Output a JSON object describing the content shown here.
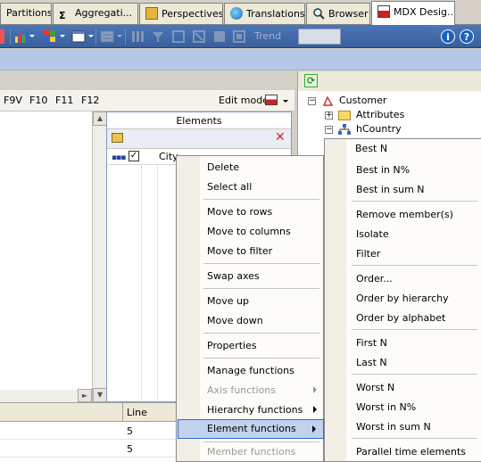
{
  "tabs": [
    {
      "label": "Partitions",
      "icon": "partitions-icon"
    },
    {
      "label": "Aggregati...",
      "icon": "sigma-icon"
    },
    {
      "label": "Perspectives",
      "icon": "perspectives-icon"
    },
    {
      "label": "Translations",
      "icon": "globe-icon"
    },
    {
      "label": "Browser",
      "icon": "magnifier-icon"
    },
    {
      "label": "MDX Desig...",
      "icon": "mdx-designer-icon",
      "active": true
    }
  ],
  "toolbar": {
    "trend_label": "Trend"
  },
  "fkeys": [
    "F9V",
    "F10",
    "F11",
    "F12"
  ],
  "edit_mode_label": "Edit mode",
  "elements": {
    "header": "Elements",
    "row_label": "City"
  },
  "bottom_grid": {
    "line_header": "Line",
    "rows": [
      "5",
      "5"
    ]
  },
  "tree": {
    "customer": "Customer",
    "attributes": "Attributes",
    "hcountry": "hCountry"
  },
  "context_menu": {
    "items": [
      {
        "label": "Delete"
      },
      {
        "label": "Select all"
      },
      {
        "label": "Move to rows"
      },
      {
        "label": "Move to columns"
      },
      {
        "label": "Move to filter"
      },
      {
        "label": "Swap axes"
      },
      {
        "label": "Move up"
      },
      {
        "label": "Move down"
      },
      {
        "label": "Properties"
      },
      {
        "label": "Manage functions"
      },
      {
        "label": "Axis functions",
        "disabled": true,
        "submenu": true
      },
      {
        "label": "Hierarchy functions",
        "submenu": true
      },
      {
        "label": "Element functions",
        "submenu": true,
        "selected": true
      },
      {
        "label": "Member functions",
        "disabled": true
      }
    ]
  },
  "submenu": {
    "items": [
      {
        "label": "Best N",
        "selected": true
      },
      {
        "label": "Best in N%"
      },
      {
        "label": "Best in sum N"
      },
      {
        "label": "Remove member(s)"
      },
      {
        "label": "Isolate"
      },
      {
        "label": "Filter"
      },
      {
        "label": "Order..."
      },
      {
        "label": "Order by hierarchy"
      },
      {
        "label": "Order by alphabet"
      },
      {
        "label": "First N"
      },
      {
        "label": "Last N"
      },
      {
        "label": "Worst N"
      },
      {
        "label": "Worst in N%"
      },
      {
        "label": "Worst in sum N"
      },
      {
        "label": "Parallel time elements"
      }
    ]
  },
  "colors": {
    "toolbar_blue": "#3a5f9c",
    "band_blue": "#b5c9e6",
    "menu_highlight": "#c1d2ee",
    "menu_highlight_border": "#316ac5",
    "delete_red": "#d42020"
  }
}
